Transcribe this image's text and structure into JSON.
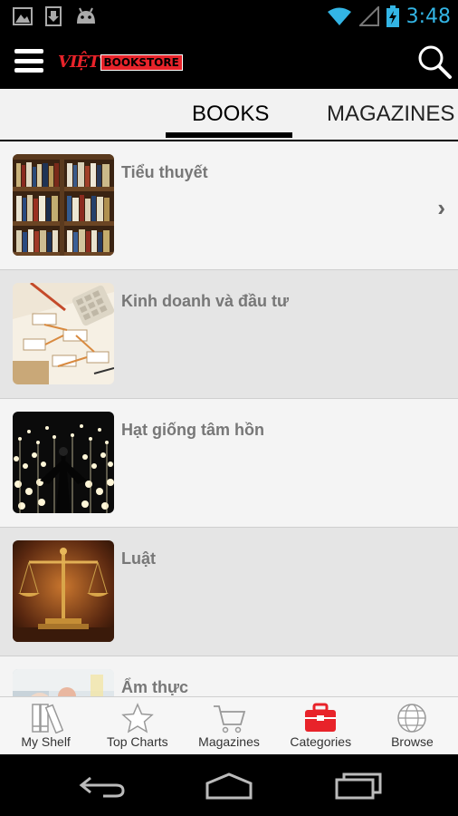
{
  "status_bar": {
    "time": "3:48",
    "left_icons": [
      "picture-icon",
      "download-icon",
      "android-icon"
    ],
    "right_icons": [
      "wifi-icon",
      "signal-icon",
      "battery-charging-icon"
    ]
  },
  "app_bar": {
    "logo_part1": "VIỆT",
    "logo_part2": "BOOKSTORE"
  },
  "tabs": [
    {
      "label": "BOOKS",
      "selected": true
    },
    {
      "label": "MAGAZINES",
      "selected": false
    }
  ],
  "categories": [
    {
      "title": "Tiểu thuyết",
      "thumb": "bookshelf"
    },
    {
      "title": "Kinh doanh và đầu tư",
      "thumb": "business-diagram"
    },
    {
      "title": "Hạt giống tâm hồn",
      "thumb": "light-field"
    },
    {
      "title": "Luật",
      "thumb": "scales"
    },
    {
      "title": "Ẩm thực",
      "thumb": "food"
    }
  ],
  "bottom_nav": [
    {
      "label": "My Shelf",
      "icon": "books-icon",
      "active": false
    },
    {
      "label": "Top Charts",
      "icon": "star-icon",
      "active": false
    },
    {
      "label": "Magazines",
      "icon": "cart-icon",
      "active": false
    },
    {
      "label": "Categories",
      "icon": "toolbox-icon",
      "active": true
    },
    {
      "label": "Browse",
      "icon": "globe-icon",
      "active": false
    }
  ],
  "colors": {
    "brand_red": "#e8232a",
    "status_blue": "#33b5e5",
    "row_light": "#f4f4f4",
    "row_dark": "#e5e5e5"
  }
}
